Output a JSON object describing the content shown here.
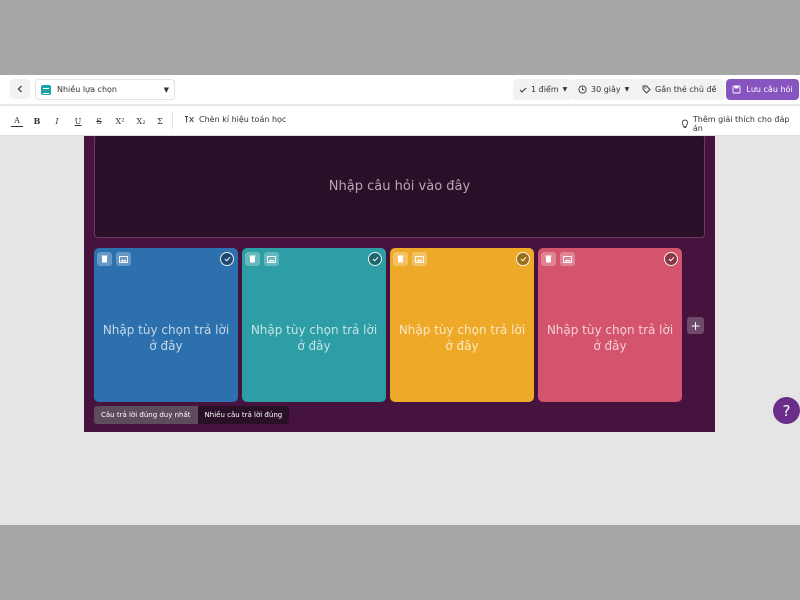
{
  "header": {
    "question_type": "Nhiều lựa chọn",
    "points": "1 điểm",
    "time": "30 giây",
    "tag_button": "Gắn thẻ chủ đề",
    "save_button": "Lưu câu hỏi"
  },
  "toolbar": {
    "format_buttons": [
      "A",
      "B",
      "I",
      "U",
      "S",
      "X²",
      "X₂",
      "Σ"
    ],
    "math_button": "Chèn kí hiệu toán học",
    "explanation_button": "Thêm giải thích cho đáp án"
  },
  "question": {
    "placeholder": "Nhập câu hỏi vào đây"
  },
  "answers": [
    {
      "placeholder_line1": "Nhập tùy chọn trả lời",
      "placeholder_line2": "ở đây",
      "color": "#2d70ae"
    },
    {
      "placeholder_line1": "Nhập tùy chọn trả lời",
      "placeholder_line2": "ở đây",
      "color": "#2d9da6"
    },
    {
      "placeholder_line1": "Nhập tùy chọn trả lời",
      "placeholder_line2": "ở đây",
      "color": "#efa929"
    },
    {
      "placeholder_line1": "Nhập tùy chọn trả lời",
      "placeholder_line2": "ở đây",
      "color": "#d5546d"
    }
  ],
  "add_option": "+",
  "answer_mode": {
    "single": "Câu trả lời đúng duy nhất",
    "multiple": "Nhiều câu trả lời đúng"
  },
  "help": "?",
  "colors": {
    "accent": "#8854c0",
    "editor_bg": "#46133e",
    "question_bg": "#2b0f29"
  }
}
